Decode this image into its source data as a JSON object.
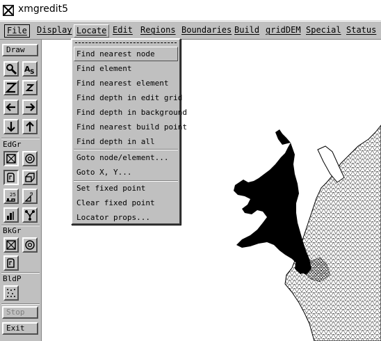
{
  "window": {
    "title": "xmgredit5",
    "icon": "xterm-style-app-icon"
  },
  "menubar": [
    {
      "label": "File",
      "state": "boxed"
    },
    {
      "label": "Display",
      "state": "normal"
    },
    {
      "label": "Locate",
      "state": "active"
    },
    {
      "label": "Edit",
      "state": "normal"
    },
    {
      "label": "Regions",
      "state": "normal"
    },
    {
      "label": "Boundaries",
      "state": "normal"
    },
    {
      "label": "Build",
      "state": "normal"
    },
    {
      "label": "gridDEM",
      "state": "normal"
    },
    {
      "label": "Special",
      "state": "normal"
    },
    {
      "label": "Status",
      "state": "normal"
    }
  ],
  "toolbar": {
    "draw_label": "Draw",
    "row1": [
      "zoom-magnifier-icon",
      "auto-scale-icon"
    ],
    "row2": [
      "zoom-Z-large-icon",
      "zoom-z-small-icon"
    ],
    "row3": [
      "pan-left-arrow-icon",
      "pan-right-arrow-icon"
    ],
    "row4": [
      "pan-down-arrow-icon",
      "pan-up-arrow-icon"
    ],
    "edgr_label": "EdGr",
    "bkgr_label": "BkGr",
    "bldp_label": "BldP",
    "stop_label": "Stop",
    "exit_label": "Exit"
  },
  "locate_menu": {
    "items_group1": [
      "Find nearest node",
      "Find element",
      "Find nearest element",
      "Find depth in edit grid",
      "Find depth in background",
      "Find nearest build point",
      "Find depth in all"
    ],
    "items_group2": [
      "Goto node/element...",
      "Goto X, Y..."
    ],
    "items_group3": [
      "Set fixed point",
      "Clear fixed point",
      "Locator props..."
    ],
    "highlighted": "Find nearest node"
  },
  "colors": {
    "chrome": "#c0c0c0",
    "canvas": "#ffffff",
    "mesh": "#000000"
  }
}
